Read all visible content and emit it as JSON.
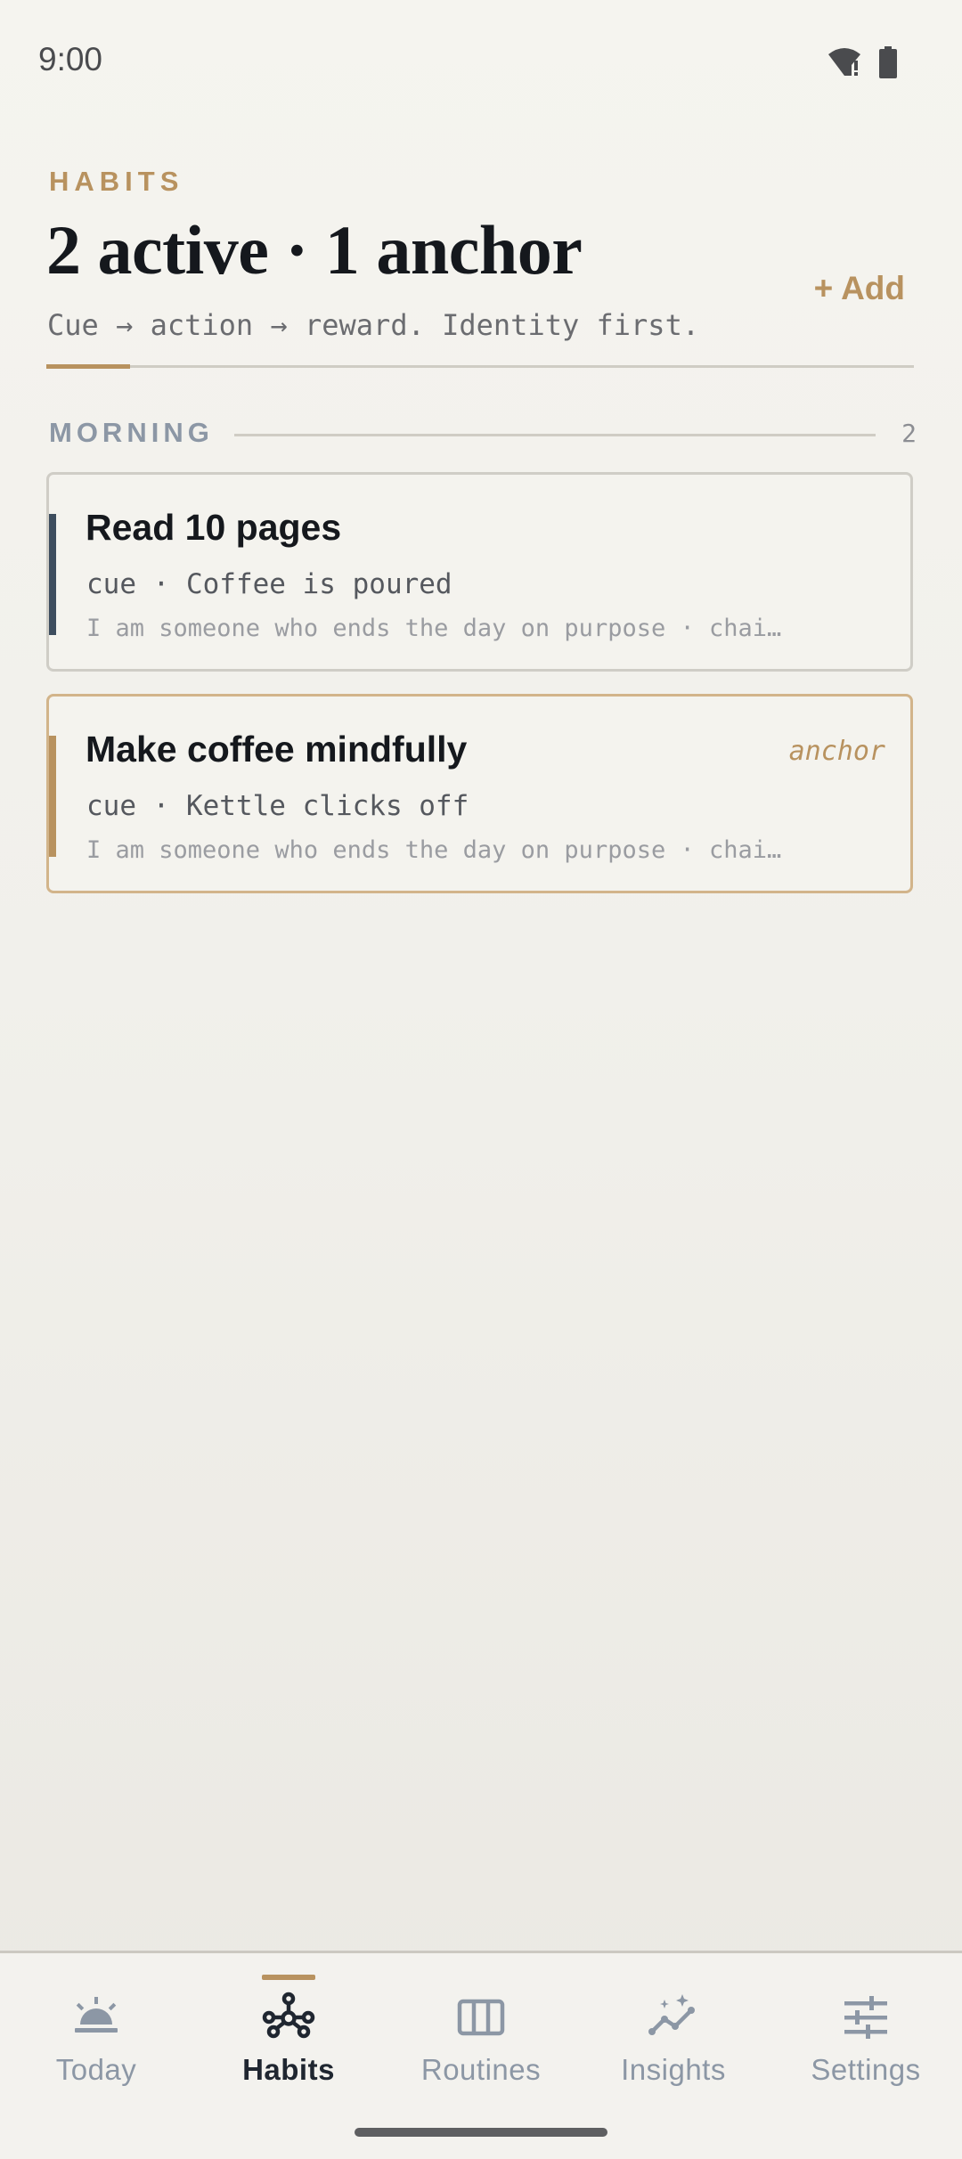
{
  "status_bar": {
    "time": "9:00",
    "icons": [
      "wifi-alert-icon",
      "battery-icon"
    ]
  },
  "header": {
    "eyebrow": "HABITS",
    "title": "2 active · 1 anchor",
    "tagline": "Cue → action → reward. Identity first.",
    "add_label": "+ Add"
  },
  "section": {
    "title": "MORNING",
    "count": "2"
  },
  "habits": [
    {
      "title": "Read 10 pages",
      "cue": "cue · Coffee is poured",
      "identity": "I am someone who ends the day on purpose  ·  chai…",
      "badge": ""
    },
    {
      "title": "Make coffee mindfully",
      "cue": "cue · Kettle clicks off",
      "identity": "I am someone who ends the day on purpose  ·  chai…",
      "badge": "anchor"
    }
  ],
  "nav": {
    "active": "Habits",
    "items": [
      {
        "label": "Today",
        "icon": "sunrise-icon"
      },
      {
        "label": "Habits",
        "icon": "network-icon"
      },
      {
        "label": "Routines",
        "icon": "columns-icon"
      },
      {
        "label": "Insights",
        "icon": "trend-sparkle-icon"
      },
      {
        "label": "Settings",
        "icon": "sliders-icon"
      }
    ]
  },
  "colors": {
    "accent": "#b8925f",
    "ink": "#15181d",
    "muted": "#8c97a5",
    "card_accent_default": "#3d4d5e"
  }
}
